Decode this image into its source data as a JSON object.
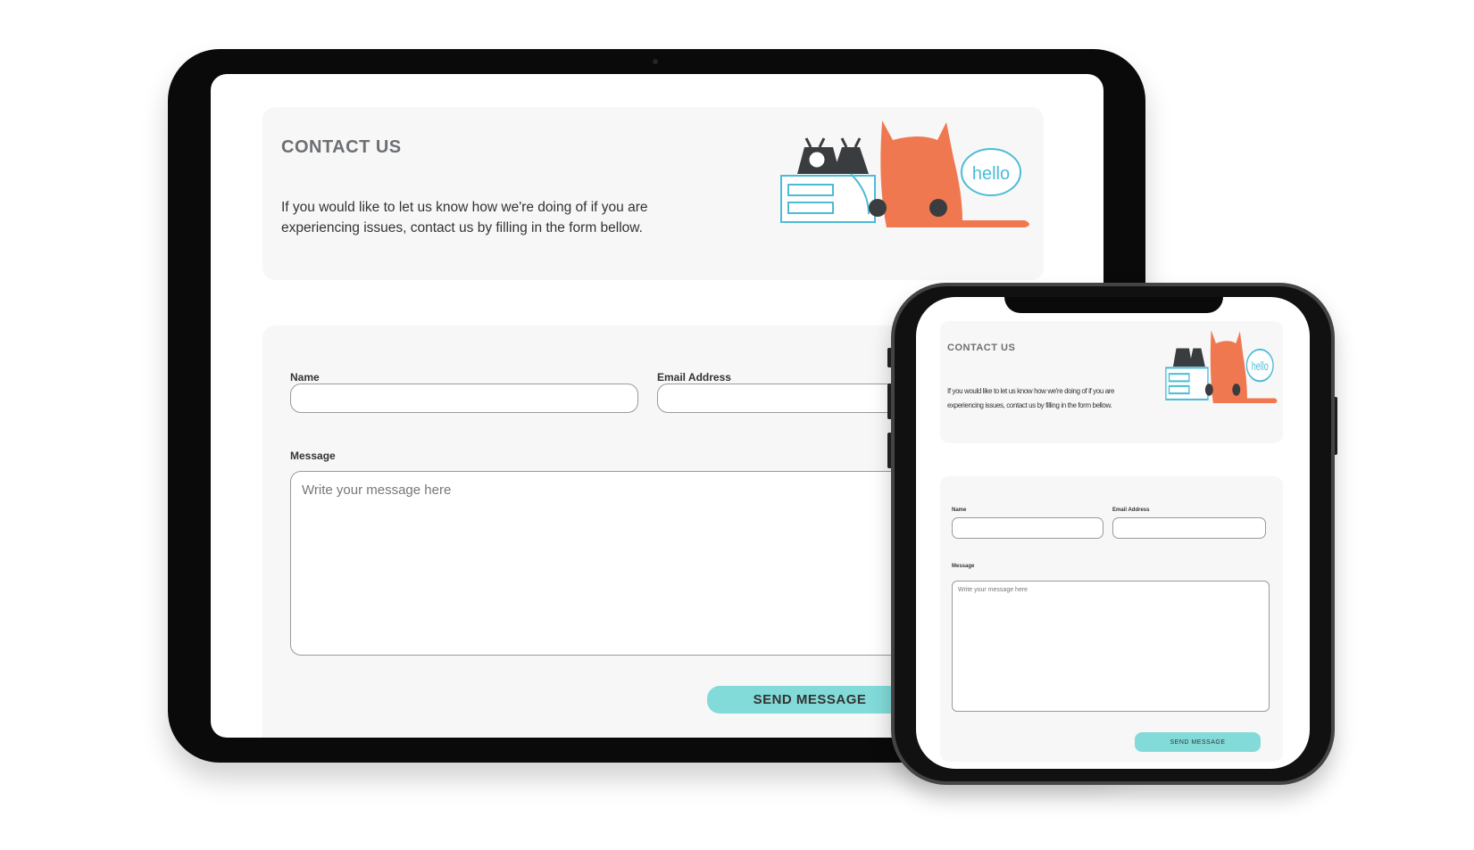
{
  "tablet": {
    "title": "CONTACT US",
    "intro_line1": "If you would like to let us know how we're doing of if you are",
    "intro_line2": "experiencing issues, contact us by filling in the form bellow.",
    "illustration_text": "hello",
    "form": {
      "name_label": "Name",
      "email_label": "Email Address",
      "message_label": "Message",
      "message_placeholder": "Write your message here",
      "submit_label": "SEND MESSAGE"
    }
  },
  "phone": {
    "title": "CONTACT US",
    "intro_line1": "If you would like to let us know how we're doing of if you are",
    "intro_line2": "experiencing issues, contact us by filling in the form bellow.",
    "illustration_text": "hello",
    "form": {
      "name_label": "Name",
      "email_label": "Email Address",
      "message_label": "Message",
      "message_placeholder": "Write your message here",
      "submit_label": "SEND MESSAGE"
    }
  },
  "colors": {
    "accent": "#82dbd9",
    "cat": "#f07850",
    "line": "#4cbcd6",
    "dark": "#3a3d3f"
  }
}
